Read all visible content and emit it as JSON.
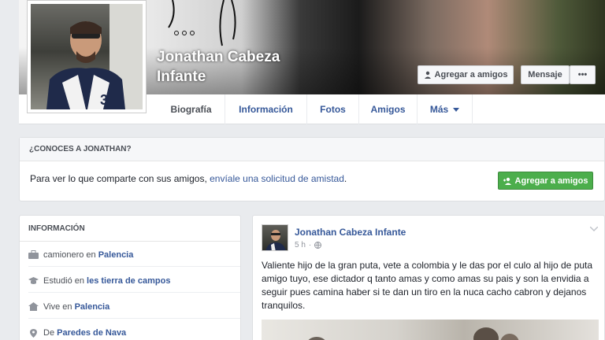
{
  "profile": {
    "name": "Jonathan Cabeza Infante"
  },
  "cover_actions": {
    "add_friend": "Agregar a amigos",
    "message": "Mensaje",
    "more": "•••"
  },
  "tabs": [
    {
      "label": "Biografía",
      "active": true
    },
    {
      "label": "Información",
      "active": false
    },
    {
      "label": "Fotos",
      "active": false
    },
    {
      "label": "Amigos",
      "active": false
    },
    {
      "label": "Más",
      "active": false
    }
  ],
  "know_box": {
    "title": "¿CONOCES A JONATHAN?",
    "text_prefix": "Para ver lo que comparte con sus amigos, ",
    "link": "envíale una solicitud de amistad",
    "text_suffix": ".",
    "button": "Agregar a amigos"
  },
  "info": {
    "title": "INFORMACIÓN",
    "rows": [
      {
        "icon": "briefcase-icon",
        "prefix": "camionero en ",
        "value": "Palencia"
      },
      {
        "icon": "graduation-cap-icon",
        "prefix": "Estudió en ",
        "value": "les tierra de campos"
      },
      {
        "icon": "home-icon",
        "prefix": "Vive en ",
        "value": "Palencia"
      },
      {
        "icon": "location-pin-icon",
        "prefix": "De ",
        "value": "Paredes de Nava"
      }
    ]
  },
  "post": {
    "author": "Jonathan Cabeza Infante",
    "time": "5 h",
    "text": "Valiente hijo de la gran puta, vete a colombia y le das por el culo al hijo de puta amigo tuyo, ese dictador q tanto amas y como amas su pais y son la envidia a seguir pues camina haber si te dan un tiro en la nuca cacho cabron y dejanos tranquilos."
  },
  "colors": {
    "link": "#365899",
    "page_bg": "#e9ebee",
    "green_button": "#4cae4c"
  }
}
